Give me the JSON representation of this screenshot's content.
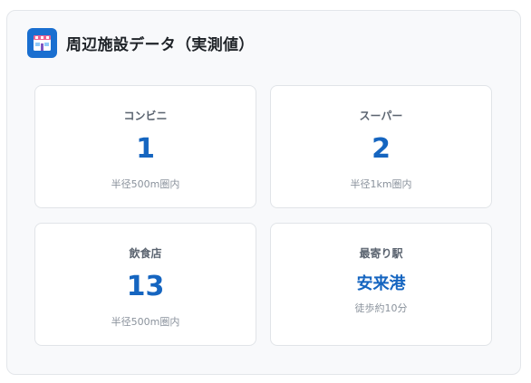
{
  "header": {
    "title": "周辺施設データ（実測値）",
    "icon": "store-icon",
    "icon_color": "#1a6fd0"
  },
  "cards": [
    {
      "label": "コンビニ",
      "value": "1",
      "note": "半径500m圏内"
    },
    {
      "label": "スーパー",
      "value": "2",
      "note": "半径1km圏内"
    },
    {
      "label": "飲食店",
      "value": "13",
      "note": "半径500m圏内"
    },
    {
      "label": "最寄り駅",
      "value": "安来港",
      "note": "徒歩約10分"
    }
  ],
  "colors": {
    "accent": "#1565c0",
    "panel_background": "#f8f9fb"
  }
}
